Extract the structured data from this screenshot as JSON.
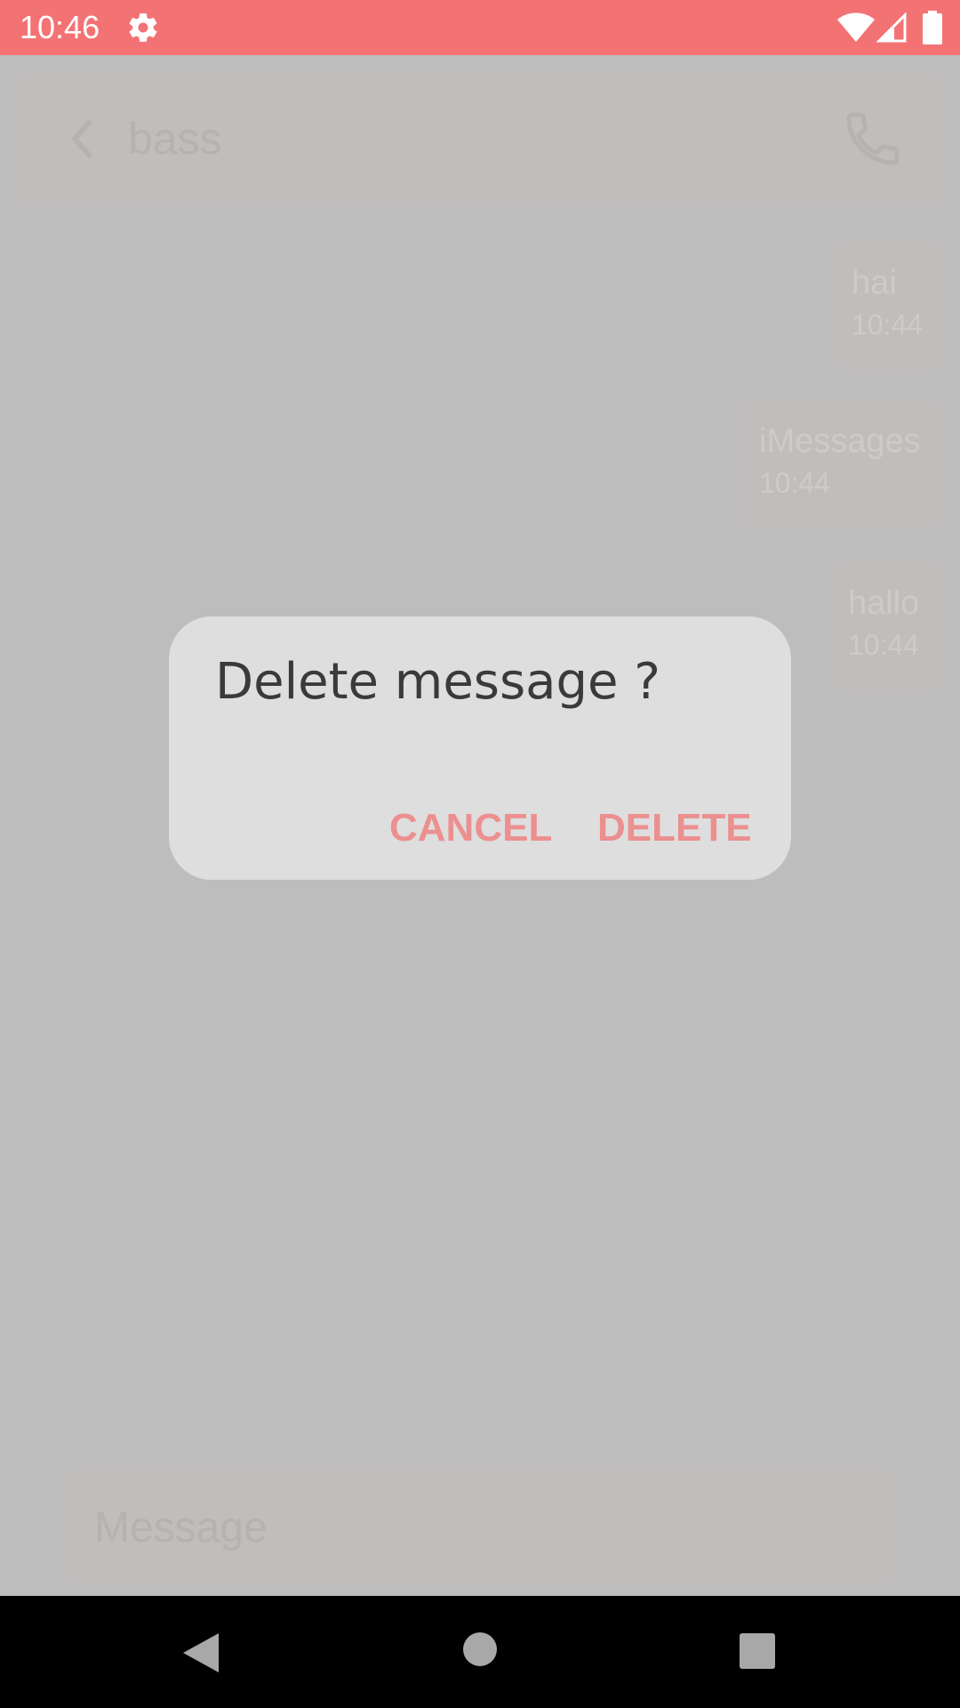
{
  "status_bar": {
    "time": "10:46",
    "color": "#f37375"
  },
  "chat": {
    "contact_name": "bass",
    "messages": [
      {
        "text": "hai",
        "time": "10:44"
      },
      {
        "text": "iMessages",
        "time": "10:44"
      },
      {
        "text": "hallo",
        "time": "10:44"
      }
    ],
    "input_placeholder": "Message"
  },
  "dialog": {
    "title": "Delete message ?",
    "cancel_label": "CANCEL",
    "delete_label": "DELETE",
    "accent_color": "#ec8f8f"
  },
  "icons": {
    "status": [
      "gear-icon",
      "wifi-icon",
      "signal-icon",
      "battery-icon"
    ],
    "appbar": [
      "back-arrow-icon",
      "phone-icon"
    ],
    "nav": [
      "nav-back-icon",
      "nav-home-icon",
      "nav-recents-icon"
    ]
  }
}
